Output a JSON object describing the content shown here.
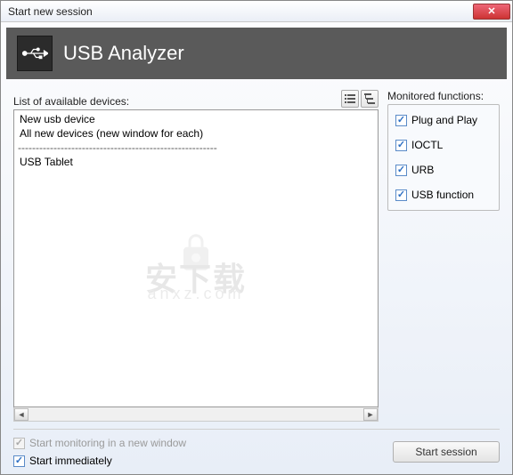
{
  "titlebar": {
    "text": "Start new session"
  },
  "header": {
    "title": "USB Analyzer"
  },
  "deviceList": {
    "label": "List of available devices:",
    "items": [
      "New usb device",
      "All new devices (new window for each)"
    ],
    "separator": "--------------------------------------------------------",
    "items2": [
      "USB Tablet"
    ]
  },
  "monitored": {
    "label": "Monitored functions:",
    "functions": [
      {
        "label": "Plug and Play",
        "checked": true
      },
      {
        "label": "IOCTL",
        "checked": true
      },
      {
        "label": "URB",
        "checked": true
      },
      {
        "label": "USB function",
        "checked": true
      }
    ]
  },
  "options": {
    "newWindow": {
      "label": "Start monitoring in a new window",
      "checked": true,
      "disabled": true
    },
    "immediately": {
      "label": "Start immediately",
      "checked": true,
      "disabled": false
    }
  },
  "buttons": {
    "start": "Start session"
  },
  "watermark": {
    "main": "安下载",
    "sub": "anxz.com"
  }
}
